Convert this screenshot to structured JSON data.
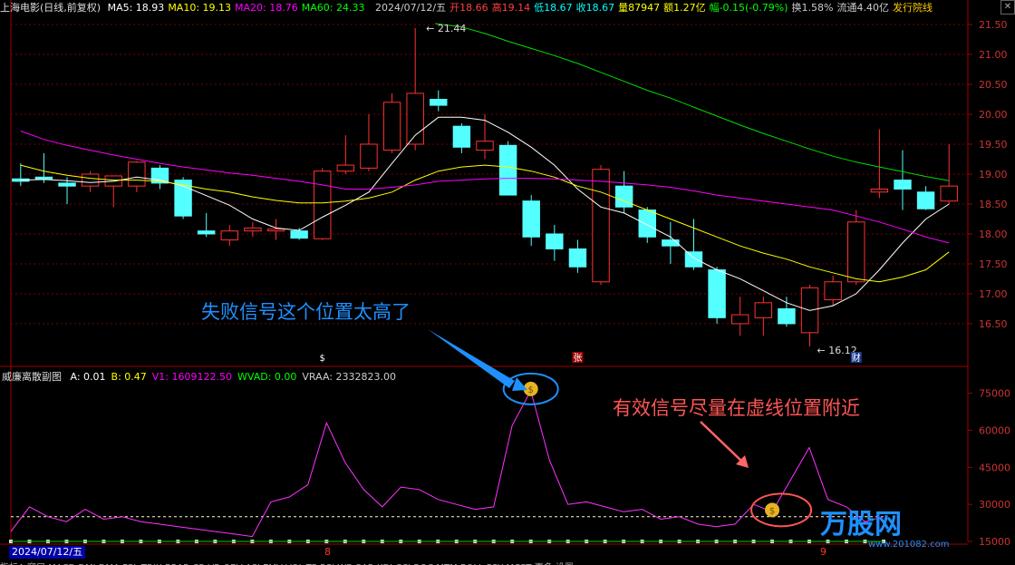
{
  "header": {
    "stock": "上海电影(日线,前复权)",
    "indicators": [
      {
        "label": "MA5: 18.93",
        "color": "#ffffff"
      },
      {
        "label": "MA10: 19.13",
        "color": "#ffff00"
      },
      {
        "label": "MA20: 18.76",
        "color": "#ff00ff"
      },
      {
        "label": "MA60: 24.33",
        "color": "#00ff00"
      }
    ],
    "quote": [
      {
        "label": "2024/07/12/五",
        "color": "#cccccc"
      },
      {
        "label": "开18.66",
        "color": "#ff4040"
      },
      {
        "label": "高19.14",
        "color": "#ff4040"
      },
      {
        "label": "低18.67",
        "color": "#00ffff"
      },
      {
        "label": "收18.67",
        "color": "#00ffff"
      },
      {
        "label": "量87947",
        "color": "#ffff00"
      },
      {
        "label": "额1.27亿",
        "color": "#ffff00"
      },
      {
        "label": "幅-0.15(-0.79%)",
        "color": "#00ff00"
      },
      {
        "label": "换1.58%",
        "color": "#cccccc"
      },
      {
        "label": "流通4.40亿",
        "color": "#cccccc"
      },
      {
        "label": "发行院线",
        "color": "#ffcc00"
      }
    ],
    "close_icon": "close-icon"
  },
  "sub_header": {
    "title": "威廉离散副图",
    "values": [
      {
        "label": "A: 0.01",
        "color": "#ffffff"
      },
      {
        "label": "B: 0.47",
        "color": "#ffff00"
      },
      {
        "label": "V1: 1609122.50",
        "color": "#ff00ff"
      },
      {
        "label": "WVAD: 0.00",
        "color": "#00ff00"
      },
      {
        "label": "VRAA: 2332823.00",
        "color": "#cccccc"
      }
    ]
  },
  "annotations": {
    "fail": {
      "text": "失败信号这个位置太高了",
      "color": "#1e90ff"
    },
    "valid": {
      "text": "有效信号尽量在虚线位置附近",
      "color": "#ff6060"
    }
  },
  "markers": {
    "s_label": "$",
    "zhang": "张",
    "cai": "财",
    "high_label": "21.44",
    "low_label": "16.12",
    "b8": "8",
    "b9": "9"
  },
  "date_box": "2024/07/12/五",
  "bottom_tabs": "指标A 窗口 MACD DMI DMA FSL TRIX BRAR CR VR OBV ASI EMV VOL-TP RSI WR SAR KDJ CCI ROC MTM BOLL PSY MCST 更多 设置",
  "watermark": {
    "brand": "万股网",
    "url": "www.201082.com"
  },
  "chart_data": [
    {
      "type": "candlestick",
      "ylim": [
        16.12,
        21.44
      ],
      "y_ticks": [
        16.5,
        17.0,
        17.5,
        18.0,
        18.5,
        19.0,
        19.5,
        20.0,
        20.5,
        21.0,
        21.5
      ],
      "candles": [
        {
          "o": 18.92,
          "h": 19.18,
          "l": 18.8,
          "c": 18.88
        },
        {
          "o": 18.95,
          "h": 19.35,
          "l": 18.85,
          "c": 18.92
        },
        {
          "o": 18.85,
          "h": 18.95,
          "l": 18.5,
          "c": 18.8
        },
        {
          "o": 18.8,
          "h": 19.05,
          "l": 18.7,
          "c": 19.0
        },
        {
          "o": 18.8,
          "h": 18.98,
          "l": 18.45,
          "c": 18.97
        },
        {
          "o": 18.8,
          "h": 19.22,
          "l": 18.7,
          "c": 19.2
        },
        {
          "o": 19.1,
          "h": 19.15,
          "l": 18.75,
          "c": 18.85
        },
        {
          "o": 18.9,
          "h": 18.95,
          "l": 18.25,
          "c": 18.3
        },
        {
          "o": 18.05,
          "h": 18.35,
          "l": 17.95,
          "c": 18.0
        },
        {
          "o": 17.9,
          "h": 18.15,
          "l": 17.8,
          "c": 18.05
        },
        {
          "o": 18.05,
          "h": 18.2,
          "l": 17.95,
          "c": 18.1
        },
        {
          "o": 18.05,
          "h": 18.25,
          "l": 17.9,
          "c": 18.08
        },
        {
          "o": 18.05,
          "h": 18.1,
          "l": 17.9,
          "c": 17.93
        },
        {
          "o": 17.92,
          "h": 19.1,
          "l": 17.9,
          "c": 19.05
        },
        {
          "o": 19.05,
          "h": 19.65,
          "l": 19.0,
          "c": 19.15
        },
        {
          "o": 19.1,
          "h": 20.0,
          "l": 19.05,
          "c": 19.5
        },
        {
          "o": 19.4,
          "h": 20.35,
          "l": 19.35,
          "c": 20.2
        },
        {
          "o": 19.5,
          "h": 21.44,
          "l": 19.4,
          "c": 20.35
        },
        {
          "o": 20.25,
          "h": 20.4,
          "l": 20.05,
          "c": 20.15
        },
        {
          "o": 19.8,
          "h": 19.85,
          "l": 19.35,
          "c": 19.45
        },
        {
          "o": 19.4,
          "h": 20.0,
          "l": 19.25,
          "c": 19.55
        },
        {
          "o": 19.48,
          "h": 19.55,
          "l": 18.7,
          "c": 18.65
        },
        {
          "o": 18.55,
          "h": 18.65,
          "l": 17.8,
          "c": 17.95
        },
        {
          "o": 18.0,
          "h": 18.15,
          "l": 17.55,
          "c": 17.75
        },
        {
          "o": 17.75,
          "h": 17.9,
          "l": 17.35,
          "c": 17.45
        },
        {
          "o": 17.2,
          "h": 19.15,
          "l": 17.15,
          "c": 19.08
        },
        {
          "o": 18.8,
          "h": 19.05,
          "l": 18.35,
          "c": 18.45
        },
        {
          "o": 18.4,
          "h": 18.45,
          "l": 17.85,
          "c": 17.95
        },
        {
          "o": 17.9,
          "h": 18.2,
          "l": 17.5,
          "c": 17.8
        },
        {
          "o": 17.7,
          "h": 18.25,
          "l": 17.4,
          "c": 17.45
        },
        {
          "o": 17.4,
          "h": 17.45,
          "l": 16.5,
          "c": 16.6
        },
        {
          "o": 16.5,
          "h": 16.95,
          "l": 16.3,
          "c": 16.65
        },
        {
          "o": 16.6,
          "h": 16.95,
          "l": 16.3,
          "c": 16.85
        },
        {
          "o": 16.75,
          "h": 16.95,
          "l": 16.45,
          "c": 16.5
        },
        {
          "o": 16.35,
          "h": 17.15,
          "l": 16.12,
          "c": 17.1
        },
        {
          "o": 16.9,
          "h": 17.3,
          "l": 16.8,
          "c": 17.2
        },
        {
          "o": 17.2,
          "h": 18.4,
          "l": 17.15,
          "c": 18.2
        },
        {
          "o": 18.7,
          "h": 19.75,
          "l": 18.6,
          "c": 18.75
        },
        {
          "o": 18.9,
          "h": 19.4,
          "l": 18.4,
          "c": 18.75
        },
        {
          "o": 18.7,
          "h": 18.8,
          "l": 18.4,
          "c": 18.42
        },
        {
          "o": 18.55,
          "h": 19.5,
          "l": 18.5,
          "c": 18.8
        }
      ],
      "ma": [
        {
          "name": "MA5",
          "color": "#ffffff",
          "values": [
            18.9,
            18.91,
            18.89,
            18.86,
            18.88,
            18.95,
            18.9,
            18.8,
            18.64,
            18.48,
            18.25,
            18.1,
            18.06,
            18.28,
            18.48,
            18.7,
            19.18,
            19.65,
            19.95,
            19.95,
            19.9,
            19.7,
            19.45,
            19.15,
            18.75,
            18.45,
            18.35,
            18.15,
            17.95,
            17.6,
            17.4,
            17.25,
            17.05,
            16.85,
            16.72,
            16.8,
            17.0,
            17.4,
            17.85,
            18.25,
            18.5
          ]
        },
        {
          "name": "MA10",
          "color": "#ffff00",
          "values": [
            19.15,
            19.05,
            18.98,
            18.93,
            18.9,
            18.9,
            18.88,
            18.82,
            18.75,
            18.7,
            18.62,
            18.56,
            18.52,
            18.52,
            18.55,
            18.6,
            18.7,
            18.9,
            19.05,
            19.12,
            19.15,
            19.12,
            19.05,
            18.95,
            18.8,
            18.7,
            18.55,
            18.4,
            18.25,
            18.1,
            17.95,
            17.8,
            17.68,
            17.58,
            17.45,
            17.35,
            17.25,
            17.2,
            17.28,
            17.4,
            17.7
          ]
        },
        {
          "name": "MA20",
          "color": "#ff00ff",
          "values": [
            19.72,
            19.58,
            19.48,
            19.4,
            19.32,
            19.25,
            19.18,
            19.12,
            19.07,
            19.02,
            18.98,
            18.93,
            18.88,
            18.82,
            18.75,
            18.75,
            18.78,
            18.82,
            18.88,
            18.9,
            18.92,
            18.93,
            18.93,
            18.92,
            18.9,
            18.88,
            18.85,
            18.82,
            18.78,
            18.72,
            18.65,
            18.6,
            18.55,
            18.5,
            18.45,
            18.4,
            18.3,
            18.2,
            18.08,
            17.95,
            17.85
          ]
        },
        {
          "name": "MA60",
          "color": "#00dd00",
          "values": [
            null,
            null,
            null,
            null,
            null,
            null,
            null,
            null,
            null,
            null,
            null,
            null,
            null,
            null,
            null,
            null,
            null,
            null,
            null,
            21.46,
            21.35,
            21.22,
            21.1,
            20.98,
            20.85,
            20.7,
            20.55,
            20.4,
            20.27,
            20.12,
            19.97,
            19.82,
            19.68,
            19.55,
            19.42,
            19.3,
            19.2,
            19.12,
            19.04,
            18.96,
            18.89
          ]
        }
      ]
    },
    {
      "type": "line",
      "name": "V1",
      "ylim": [
        15000,
        80000
      ],
      "y_ticks": [
        15000,
        30000,
        45000,
        60000,
        75000
      ],
      "dashed_level": 25000,
      "values": [
        19000,
        29000,
        25000,
        23000,
        28000,
        24000,
        25000,
        23000,
        22000,
        21000,
        20000,
        19000,
        18000,
        17000,
        31000,
        33000,
        38000,
        63000,
        47000,
        36000,
        29000,
        37000,
        36000,
        32000,
        30000,
        28000,
        29000,
        62000,
        76000,
        48000,
        30000,
        31000,
        29000,
        27000,
        28000,
        24000,
        25000,
        22000,
        21000,
        22000,
        30000,
        27000,
        40000,
        53000,
        32000,
        29000,
        23000,
        25000
      ],
      "signals": [
        28,
        41
      ]
    }
  ]
}
